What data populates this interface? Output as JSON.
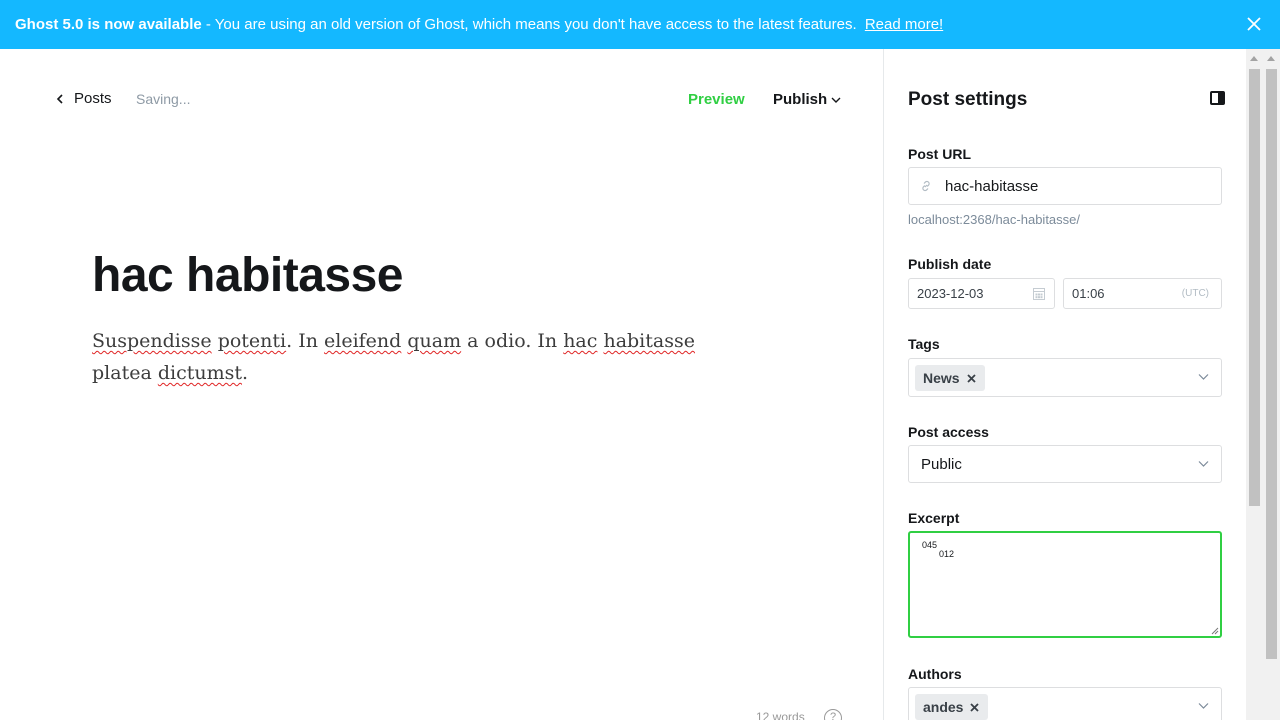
{
  "banner": {
    "headline": "Ghost 5.0 is now available",
    "message": " - You are using an old version of Ghost, which means you don't have access to the latest features. ",
    "link": "Read more!"
  },
  "toolbar": {
    "back_label": "Posts",
    "status": "Saving...",
    "preview_label": "Preview",
    "publish_label": "Publish"
  },
  "post": {
    "title": "hac habitasse",
    "body_parts": [
      "Suspendisse",
      " ",
      "potenti",
      ". In ",
      "eleifend",
      " ",
      "quam",
      " a odio. In ",
      "hac",
      " ",
      "habitasse",
      " platea ",
      "dictumst",
      "."
    ]
  },
  "editor_footer": {
    "word_count": "12 words",
    "help_glyph": "?"
  },
  "settings": {
    "title": "Post settings",
    "url_label": "Post URL",
    "url_value": "hac-habitasse",
    "url_hint": "localhost:2368/hac-habitasse/",
    "date_label": "Publish date",
    "date_value": "2023-12-03",
    "time_value": "01:06",
    "timezone": "(UTC)",
    "tags_label": "Tags",
    "tags": [
      "News"
    ],
    "access_label": "Post access",
    "access_value": "Public",
    "excerpt_label": "Excerpt",
    "excerpt_line1": "045",
    "excerpt_line2": "012",
    "authors_label": "Authors",
    "authors": [
      "andes"
    ]
  },
  "colors": {
    "banner_bg": "#14b8ff",
    "accent_green": "#30cf43",
    "text_dark": "#15171a"
  }
}
